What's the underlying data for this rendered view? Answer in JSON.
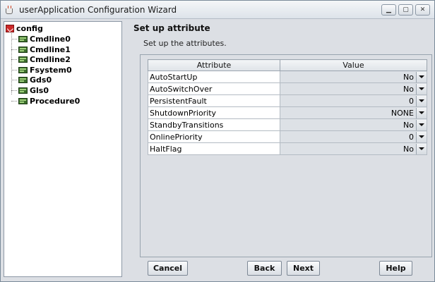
{
  "window": {
    "title": "userApplication Configuration Wizard",
    "icon": "java-cup-icon",
    "controls": [
      "minimize",
      "maximize",
      "close"
    ]
  },
  "tree": {
    "root": "config",
    "items": [
      "Cmdline0",
      "Cmdline1",
      "Cmdline2",
      "Fsystem0",
      "Gds0",
      "Gls0",
      "Procedure0"
    ]
  },
  "main": {
    "heading": "Set up attribute",
    "subtext": "Set up the attributes.",
    "table": {
      "columns": [
        "Attribute",
        "Value"
      ],
      "rows": [
        {
          "attribute": "AutoStartUp",
          "value": "No"
        },
        {
          "attribute": "AutoSwitchOver",
          "value": "No"
        },
        {
          "attribute": "PersistentFault",
          "value": "0"
        },
        {
          "attribute": "ShutdownPriority",
          "value": "NONE"
        },
        {
          "attribute": "StandbyTransitions",
          "value": "No"
        },
        {
          "attribute": "OnlinePriority",
          "value": "0"
        },
        {
          "attribute": "HaltFlag",
          "value": "No"
        }
      ]
    }
  },
  "buttons": {
    "cancel": "Cancel",
    "back": "Back",
    "next": "Next",
    "help": "Help"
  },
  "colors": {
    "window_bg": "#dcdfe4",
    "config_icon": "#cc2a2a",
    "resource_icon": "#3c6e2c"
  }
}
